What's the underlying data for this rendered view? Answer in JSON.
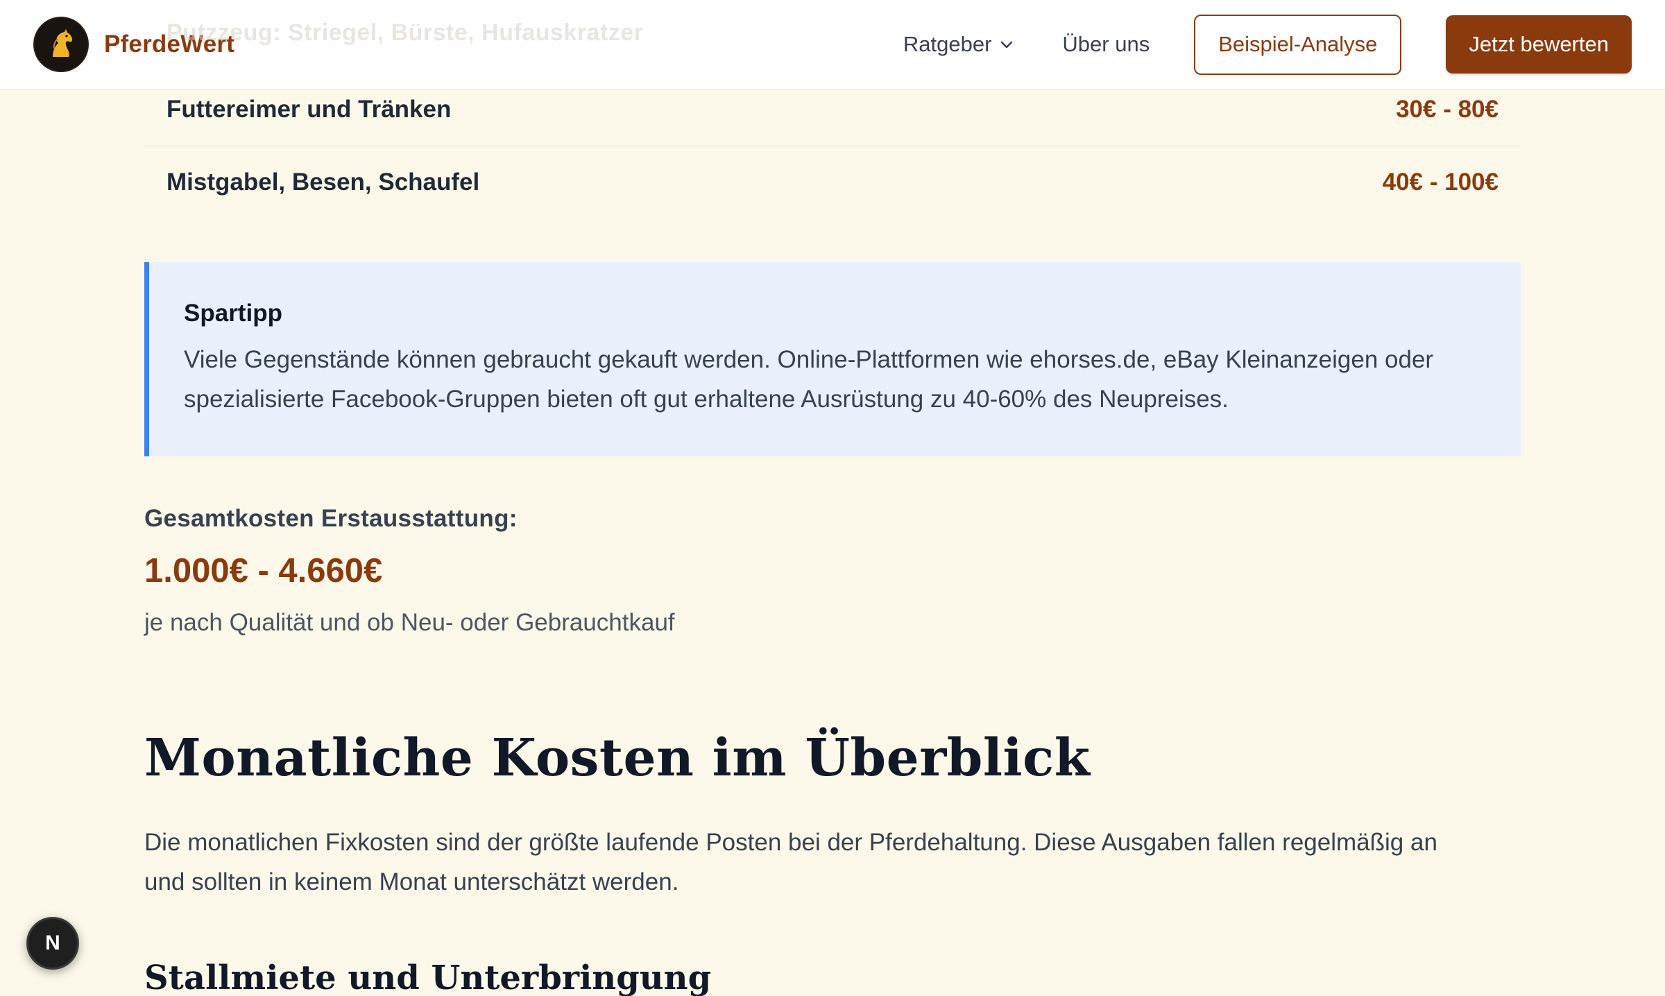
{
  "header": {
    "brand": "PferdeWert",
    "ghost_text": "Putzzeug: Striegel, Bürste, Hufauskratzer",
    "nav": {
      "ratgeber": "Ratgeber",
      "about": "Über uns",
      "example_button": "Beispiel-Analyse",
      "cta_button": "Jetzt bewerten"
    }
  },
  "equipment_table": {
    "rows": [
      {
        "name": "Futtereimer und Tränken",
        "price": "30€ - 80€"
      },
      {
        "name": "Mistgabel, Besen, Schaufel",
        "price": "40€ - 100€"
      }
    ]
  },
  "tip": {
    "title": "Spartipp",
    "text_line1": "Viele Gegenstände können gebraucht gekauft werden. Online-Plattformen wie ehorses.de, eBay Kleinanzeigen oder",
    "text_line2": "spezialisierte Facebook-Gruppen bieten oft gut erhaltene Ausrüstung zu 40-60% des Neupreises."
  },
  "total": {
    "label": "Gesamtkosten Erstausstattung:",
    "value": "1.000€ - 4.660€",
    "note": "je nach Qualität und ob Neu- oder Gebrauchtkauf"
  },
  "section": {
    "heading": "Monatliche Kosten im Überblick",
    "paragraph_line1": "Die monatlichen Fixkosten sind der größte laufende Posten bei der Pferdehaltung. Diese Ausgaben fallen regelmäßig an",
    "paragraph_line2": "und sollten in keinem Monat unterschätzt werden.",
    "subheading": "Stallmiete und Unterbringung"
  },
  "fab": {
    "label": "N"
  },
  "colors": {
    "accent": "#8b3a0e",
    "page_bg": "#fdf9ea",
    "tip_bg": "#eaf1fd",
    "tip_border": "#3b82f6"
  }
}
